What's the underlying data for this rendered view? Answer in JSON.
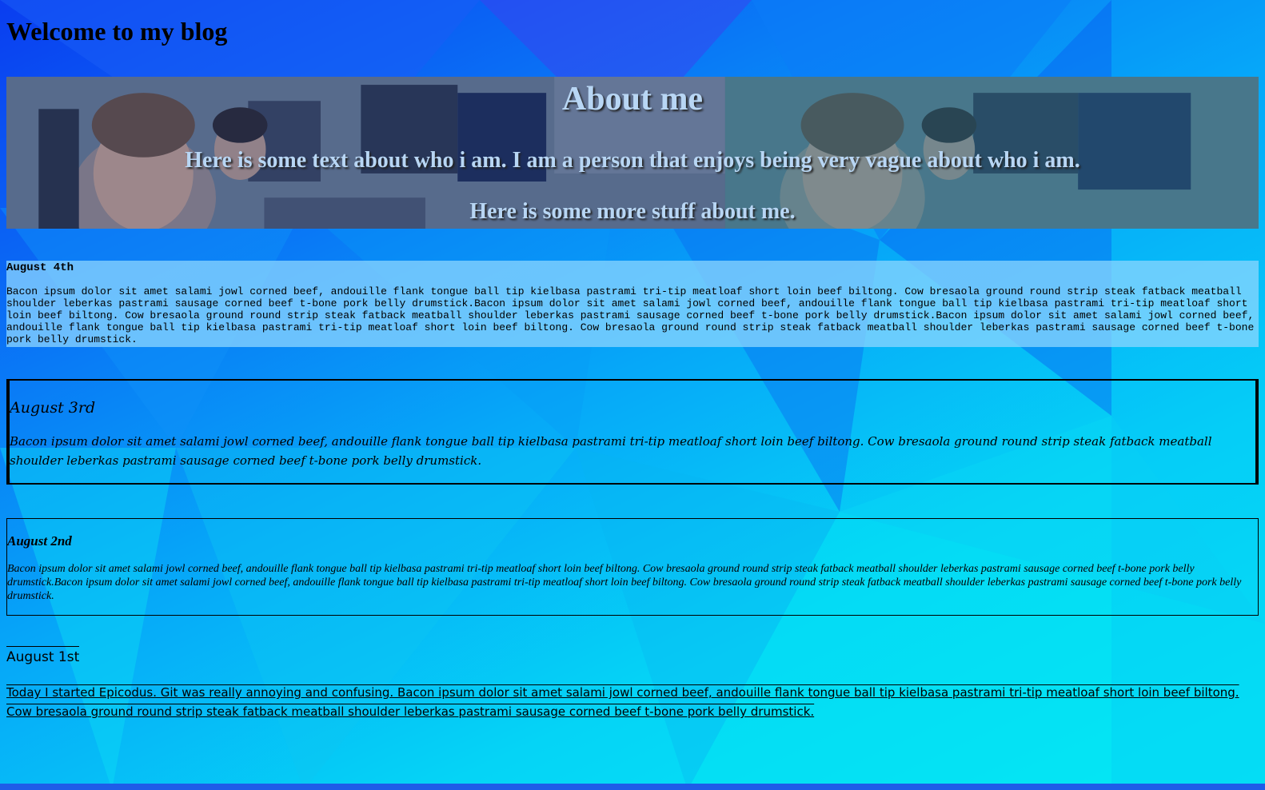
{
  "page": {
    "title": "Welcome to my blog"
  },
  "about": {
    "heading": "About me",
    "line1": "Here is some text about who i am. I am a person that enjoys being very vague about who i am.",
    "line2": "Here is some more stuff about me."
  },
  "posts": [
    {
      "date": "August 4th",
      "body": "Bacon ipsum dolor sit amet salami jowl corned beef, andouille flank tongue ball tip kielbasa pastrami tri-tip meatloaf short loin beef biltong. Cow bresaola ground round strip steak fatback meatball shoulder leberkas pastrami sausage corned beef t-bone pork belly drumstick.Bacon ipsum dolor sit amet salami jowl corned beef, andouille flank tongue ball tip kielbasa pastrami tri-tip meatloaf short loin beef biltong. Cow bresaola ground round strip steak fatback meatball shoulder leberkas pastrami sausage corned beef t-bone pork belly drumstick.Bacon ipsum dolor sit amet salami jowl corned beef, andouille flank tongue ball tip kielbasa pastrami tri-tip meatloaf short loin beef biltong. Cow bresaola ground round strip steak fatback meatball shoulder leberkas pastrami sausage corned beef t-bone pork belly drumstick."
    },
    {
      "date": "August 3rd",
      "body": "Bacon ipsum dolor sit amet salami jowl corned beef, andouille flank tongue ball tip kielbasa pastrami tri-tip meatloaf short loin beef biltong. Cow bresaola ground round strip steak fatback meatball shoulder leberkas pastrami sausage corned beef t-bone pork belly drumstick."
    },
    {
      "date": "August 2nd",
      "body": "Bacon ipsum dolor sit amet salami jowl corned beef, andouille flank tongue ball tip kielbasa pastrami tri-tip meatloaf short loin beef biltong. Cow bresaola ground round strip steak fatback meatball shoulder leberkas pastrami sausage corned beef t-bone pork belly drumstick.Bacon ipsum dolor sit amet salami jowl corned beef, andouille flank tongue ball tip kielbasa pastrami tri-tip meatloaf short loin beef biltong. Cow bresaola ground round strip steak fatback meatball shoulder leberkas pastrami sausage corned beef t-bone pork belly drumstick."
    },
    {
      "date": "August 1st",
      "body": "Today I started Epicodus. Git was really annoying and confusing. Bacon ipsum dolor sit amet salami jowl corned beef, andouille flank tongue ball tip kielbasa pastrami tri-tip meatloaf short loin beef biltong. Cow bresaola ground round strip steak fatback meatball shoulder leberkas pastrami sausage corned beef t-bone pork belly drumstick."
    }
  ],
  "colors": {
    "about_text": "#b8d6f4",
    "post1_bg": "#8cd6ff",
    "page_bg_top": "#0a3df0",
    "page_bg_bottom": "#05eaf4"
  },
  "images": {
    "about_banner": "photo-of-students-at-computers"
  }
}
